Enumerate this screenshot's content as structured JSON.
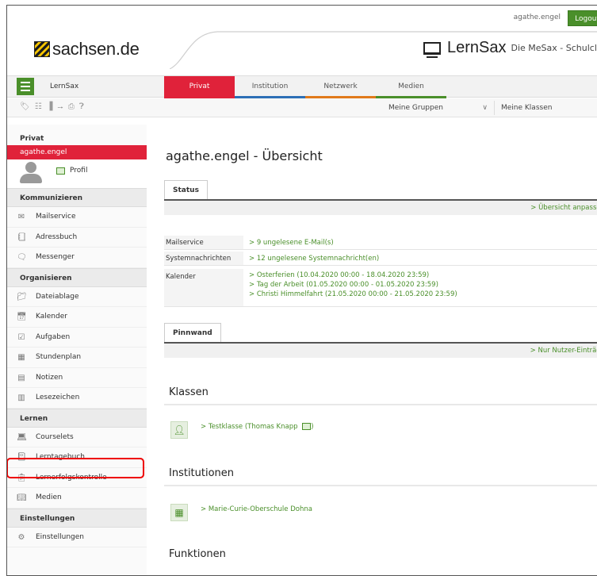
{
  "topbar": {
    "username": "agathe.engel",
    "logout": "Logout"
  },
  "header": {
    "sachsen_logo": "sachsen.de",
    "app_title": "LernSax",
    "app_subtitle": "Die MeSax - Schulcloud"
  },
  "nav": {
    "brand": "LernSax",
    "tabs": [
      "Privat",
      "Institution",
      "Netzwerk",
      "Medien"
    ]
  },
  "toolbar": {
    "icons": [
      "tag-icon",
      "list-icon",
      "bookmark-icon",
      "import-icon",
      "print-icon",
      "help-icon"
    ],
    "groups_select": "Meine Gruppen",
    "classes_select": "Meine Klassen"
  },
  "sidebar": {
    "privat_header": "Privat",
    "user": "agathe.engel",
    "profile": "Profil",
    "sections": [
      {
        "title": "Kommunizieren",
        "items": [
          "Mailservice",
          "Adressbuch",
          "Messenger"
        ]
      },
      {
        "title": "Organisieren",
        "items": [
          "Dateiablage",
          "Kalender",
          "Aufgaben",
          "Stundenplan",
          "Notizen",
          "Lesezeichen"
        ]
      },
      {
        "title": "Lernen",
        "items": [
          "Courselets",
          "Lerntagebuch",
          "Lernerfolgskontrolle",
          "Medien"
        ]
      },
      {
        "title": "Einstellungen",
        "items": [
          "Einstellungen"
        ]
      }
    ]
  },
  "main": {
    "title": "agathe.engel - Übersicht",
    "status_tab": "Status",
    "status_bar_link": "> Übersicht anpassen",
    "rows": [
      {
        "label": "Mailservice",
        "values": [
          "> 9 ungelesene E-Mail(s)"
        ]
      },
      {
        "label": "Systemnachrichten",
        "values": [
          "> 12 ungelesene Systemnachricht(en)"
        ]
      },
      {
        "label": "Kalender",
        "values": [
          "> Osterferien (10.04.2020 00:00 - 18.04.2020 23:59)",
          "> Tag der Arbeit (01.05.2020 00:00 - 01.05.2020 23:59)",
          "> Christi Himmelfahrt (21.05.2020 00:00 - 21.05.2020 23:59)"
        ]
      }
    ],
    "pinnwand_tab": "Pinnwand",
    "pinnwand_bar_link": "> Nur Nutzer-Einträge",
    "klassen_title": "Klassen",
    "klassen_link": "> Testklasse (Thomas Knapp",
    "institutionen_title": "Institutionen",
    "institutionen_link": "> Marie-Curie-Oberschule Dohna",
    "funktionen_title": "Funktionen"
  },
  "colors": {
    "accent_red": "#e0223a",
    "accent_green": "#4a8f2a"
  }
}
